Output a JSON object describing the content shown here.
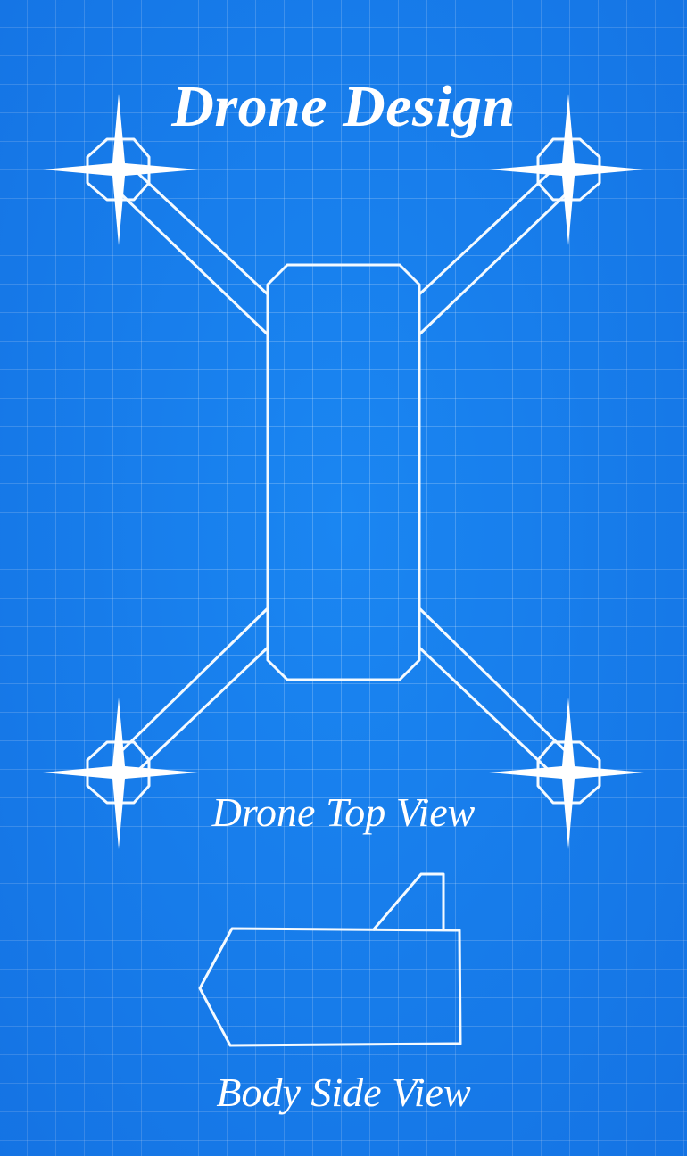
{
  "diagram": {
    "title": "Drone Design",
    "top_view_caption": "Drone Top View",
    "side_view_caption": "Body Side View",
    "background_color": "#1a86f2",
    "line_color": "#ffffff"
  }
}
